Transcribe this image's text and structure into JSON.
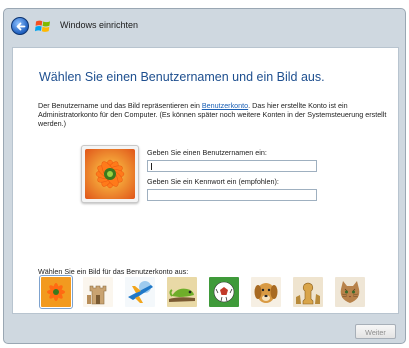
{
  "window": {
    "title": "Windows einrichten",
    "back_icon": "back-arrow-icon",
    "logo_icon": "windows-logo-icon"
  },
  "main": {
    "heading": "Wählen Sie einen Benutzernamen und ein Bild aus.",
    "intro_before_link": "Der Benutzername und das Bild repräsentieren ein ",
    "intro_link": "Benutzerkonto",
    "intro_after_link": ". Das hier erstellte Konto ist ein Administratorkonto für den Computer. (Es können später noch weitere Konten in der Systemsteuerung erstellt werden.)",
    "username_label": "Geben Sie einen Benutzernamen ein:",
    "username_value": "",
    "password_label": "Geben Sie ein Kennwort ein (empfohlen):",
    "password_value": "",
    "picture_prompt": "Wählen Sie ein Bild für das Benutzerkonto aus:",
    "pictures": [
      {
        "icon": "flower-icon",
        "selected": true
      },
      {
        "icon": "chess-castle-icon",
        "selected": false
      },
      {
        "icon": "airplane-icon",
        "selected": false
      },
      {
        "icon": "chameleon-icon",
        "selected": false
      },
      {
        "icon": "soccer-ball-icon",
        "selected": false
      },
      {
        "icon": "dog-icon",
        "selected": false
      },
      {
        "icon": "chess-piece-icon",
        "selected": false
      },
      {
        "icon": "cat-icon",
        "selected": false
      }
    ]
  },
  "footer": {
    "next_label": "Weiter"
  },
  "colors": {
    "heading": "#1e4f8f",
    "link": "#1a5fb4",
    "frame": "#cfd8e0"
  }
}
